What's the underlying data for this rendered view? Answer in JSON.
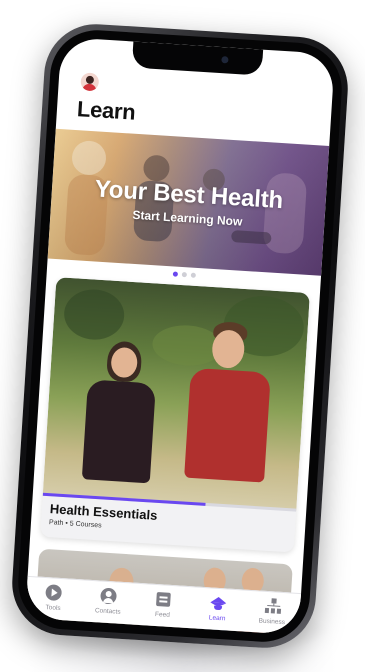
{
  "header": {
    "title": "Learn",
    "avatar_icon": "user-avatar"
  },
  "hero": {
    "title": "Your Best Health",
    "subtitle": "Start Learning Now",
    "page_count": 3,
    "active_page": 1
  },
  "featured_card": {
    "title": "Health Essentials",
    "meta": "Path • 5 Courses",
    "progress": 0.64
  },
  "tabbar": {
    "items": [
      {
        "label": "Tools",
        "icon": "play-circle-icon",
        "active": false
      },
      {
        "label": "Contacts",
        "icon": "contact-icon",
        "active": false
      },
      {
        "label": "Feed",
        "icon": "feed-icon",
        "active": false
      },
      {
        "label": "Learn",
        "icon": "graduation-cap-icon",
        "active": true
      },
      {
        "label": "Business",
        "icon": "org-chart-icon",
        "active": false
      }
    ]
  },
  "colors": {
    "accent": "#6a48f0",
    "tab_inactive": "#8d8d95",
    "title_text": "#111111"
  }
}
